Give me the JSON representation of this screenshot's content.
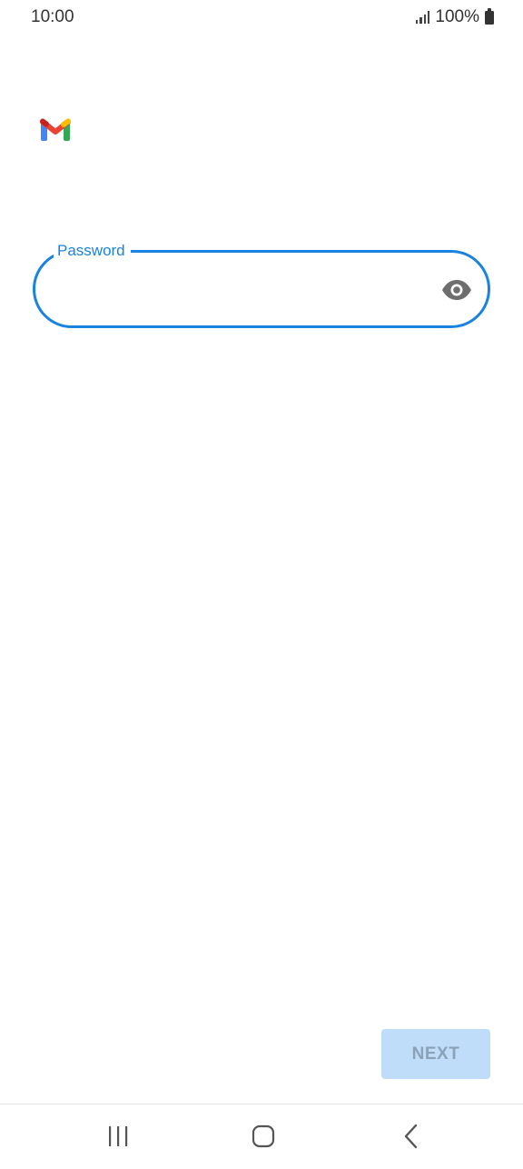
{
  "status_bar": {
    "time": "10:00",
    "battery_text": "100%",
    "icons": [
      "signal-icon",
      "battery-icon"
    ]
  },
  "app": {
    "logo": "gmail-logo"
  },
  "password_field": {
    "label": "Password",
    "value": "",
    "toggle_icon": "eye-icon"
  },
  "next_button": {
    "label": "NEXT",
    "enabled": false
  },
  "nav_bar": {
    "buttons": [
      "recents-icon",
      "home-icon",
      "back-icon"
    ]
  },
  "colors": {
    "accent": "#1a82e0",
    "next_bg_disabled": "#bfdcf8",
    "next_text_disabled": "#8ba2b6",
    "gmail_red": "#ea4335",
    "gmail_blue": "#4285f4",
    "gmail_green": "#34a853",
    "gmail_yellow": "#fbbc04"
  }
}
